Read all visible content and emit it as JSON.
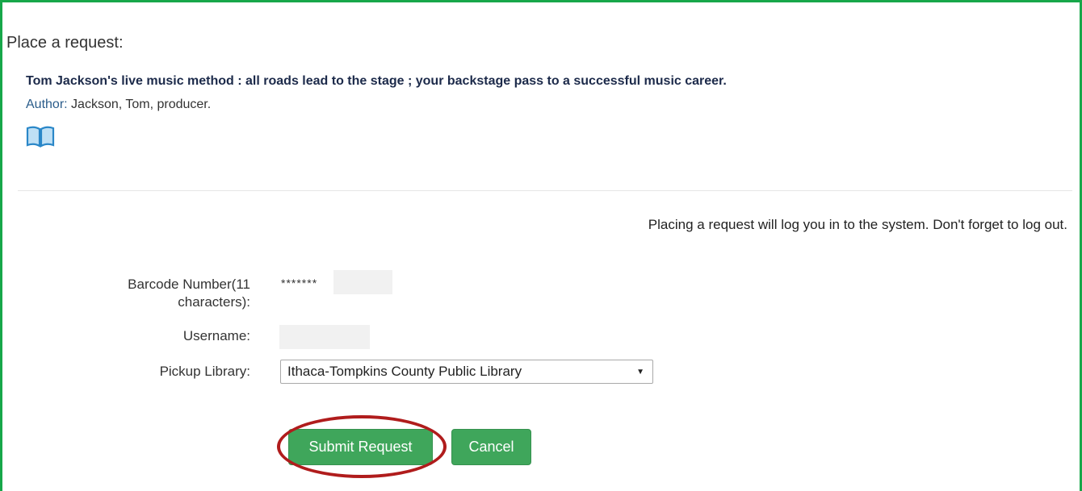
{
  "page": {
    "title": "Place a request:"
  },
  "item": {
    "title": "Tom Jackson's live music method : all roads lead to the stage ; your backstage pass to a successful music career.",
    "author_label": "Author:",
    "author_value": "Jackson, Tom, producer.",
    "format_icon": "book-icon"
  },
  "notice": "Placing a request will log you in to the system. Don't forget to log out.",
  "form": {
    "barcode_label_line1": "Barcode Number(11",
    "barcode_label_line2": "characters):",
    "barcode_value": "*******",
    "username_label": "Username:",
    "pickup_label": "Pickup Library:",
    "pickup_selected": "Ithaca-Tompkins County Public Library"
  },
  "buttons": {
    "submit": "Submit Request",
    "cancel": "Cancel"
  },
  "colors": {
    "frame": "#17a74a",
    "button": "#3fa65b",
    "highlight": "#b01c1c",
    "icon": "#2a87c8"
  }
}
